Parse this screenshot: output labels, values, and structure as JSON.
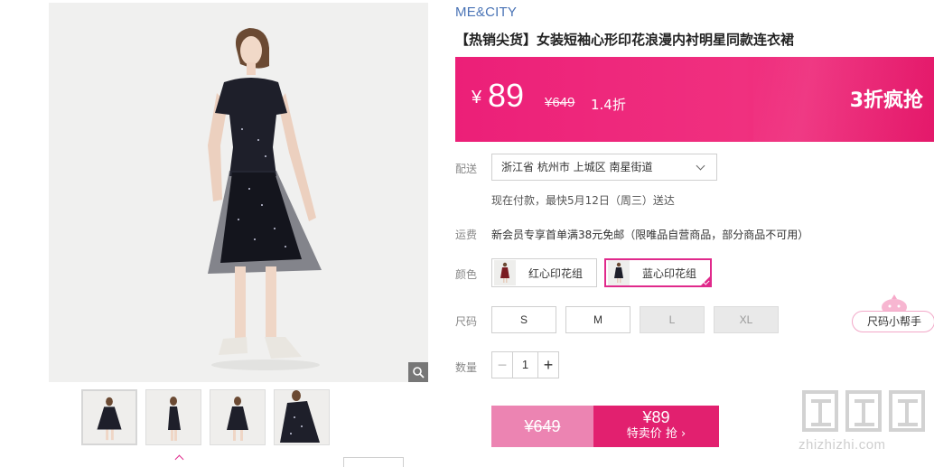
{
  "product": {
    "brand": "ME&CITY",
    "title": "【热销尖货】女装短袖心形印花浪漫内衬明星同款连衣裙"
  },
  "price_banner": {
    "currency": "¥",
    "price": "89",
    "original_price": "¥649",
    "discount": "1.4折",
    "promo_text": "3折疯抢"
  },
  "delivery": {
    "label": "配送",
    "address": "浙江省 杭州市 上城区 南星街道",
    "eta": "现在付款，最快5月12日（周三）送达"
  },
  "shipping": {
    "label": "运费",
    "text": "新会员专享首单满38元免邮（限唯品自营商品，部分商品不可用）"
  },
  "colors": {
    "label": "颜色",
    "options": [
      {
        "name": "红心印花组",
        "selected": false
      },
      {
        "name": "蓝心印花组",
        "selected": true
      }
    ]
  },
  "sizes": {
    "label": "尺码",
    "options": [
      {
        "name": "S",
        "available": true
      },
      {
        "name": "M",
        "available": true
      },
      {
        "name": "L",
        "available": false
      },
      {
        "name": "XL",
        "available": false
      }
    ]
  },
  "quantity": {
    "label": "数量",
    "value": "1",
    "minus": "−",
    "plus": "+"
  },
  "buy": {
    "original_price": "¥649",
    "sale_price": "¥89",
    "sale_label": "特卖价 抢 ›"
  },
  "size_helper": {
    "label": "尺码小帮手"
  },
  "watermark": {
    "text": "zhizhizhi.com"
  },
  "colors_theme": {
    "accent": "#e2206f",
    "banner": "#ec1f78",
    "brand": "#4a74b6"
  }
}
